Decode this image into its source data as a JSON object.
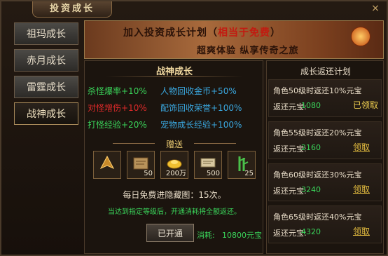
{
  "window": {
    "title": "投资成长",
    "close_icon": "×"
  },
  "nav": {
    "items": [
      {
        "label": "祖玛成长",
        "active": false
      },
      {
        "label": "赤月成长",
        "active": false
      },
      {
        "label": "雷霆成长",
        "active": false
      },
      {
        "label": "战神成长",
        "active": true
      }
    ]
  },
  "banner": {
    "line1_prefix": "加入投资成长计划（",
    "line1_highlight": "相当于免费",
    "line1_suffix": "）",
    "line2": "超爽体验  纵享传奇之旅"
  },
  "panel": {
    "title": "战神成长",
    "stats_left": [
      {
        "text": "杀怪爆率+10%",
        "color": "#3ad45a"
      },
      {
        "text": "对怪增伤+10%",
        "color": "#e02a2a"
      },
      {
        "text": "打怪经验+20%",
        "color": "#3ad45a"
      }
    ],
    "stats_right": [
      {
        "text": "人物回收金币+50%",
        "color": "#3aa8e0"
      },
      {
        "text": "配饰回收荣誉+100%",
        "color": "#3aa8e0"
      },
      {
        "text": "宠物成长经验+100%",
        "color": "#3aa8e0"
      }
    ],
    "gift_title": "赠送",
    "gifts": [
      {
        "icon": "armor-piece-icon",
        "qty": ""
      },
      {
        "icon": "treasure-map-icon",
        "qty": "50"
      },
      {
        "icon": "gold-ingot-icon",
        "qty": "200万"
      },
      {
        "icon": "scroll-icon",
        "qty": "500"
      },
      {
        "icon": "bamboo-icon",
        "qty": "25"
      }
    ],
    "daily": "每日免费进隐藏图：15次。",
    "note": "当达到指定等级后，开通消耗将全额返还。",
    "activated_button": "已开通",
    "cost_label": "消耗:",
    "cost_value": "10800元宝"
  },
  "rewards": {
    "title": "成长返还计划",
    "rows": [
      {
        "desc": "角色50级时返还10%元宝",
        "label": "返还元宝:",
        "value": "1080",
        "button": "已领取",
        "claimed": true
      },
      {
        "desc": "角色55级时返还20%元宝",
        "label": "返还元宝:",
        "value": "2160",
        "button": "领取",
        "claimed": false
      },
      {
        "desc": "角色60级时返还30%元宝",
        "label": "返还元宝:",
        "value": "3240",
        "button": "领取",
        "claimed": false
      },
      {
        "desc": "角色65级时返还40%元宝",
        "label": "返还元宝:",
        "value": "4320",
        "button": "领取",
        "claimed": false
      }
    ]
  }
}
